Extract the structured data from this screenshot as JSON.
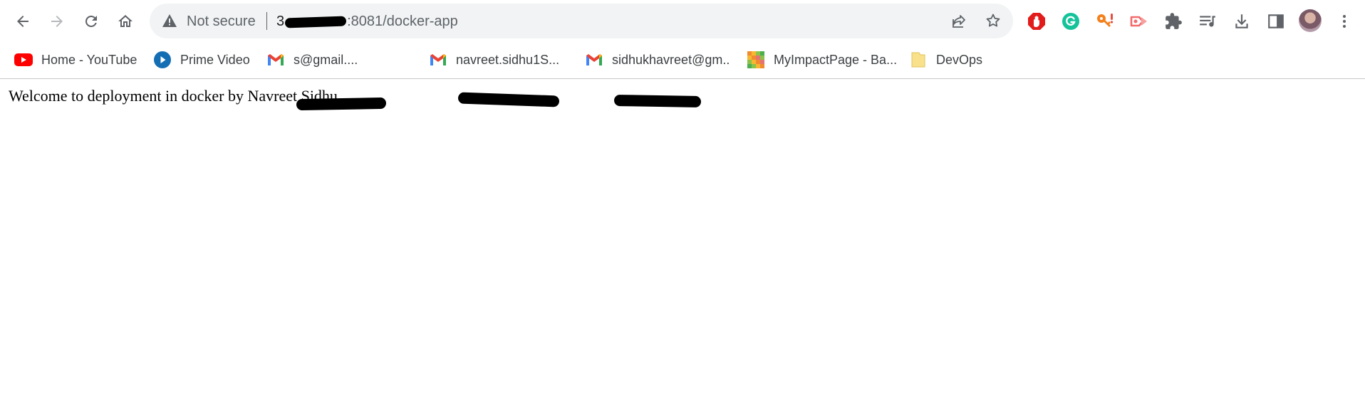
{
  "browser": {
    "nav": {
      "back_label": "Back",
      "forward_label": "Forward",
      "reload_label": "Reload",
      "home_label": "Home"
    },
    "omnibox": {
      "security_text": "Not secure",
      "url_visible_prefix": "3",
      "url_visible_suffix": ":8081/docker-app",
      "redacted": true
    },
    "extensions": [
      {
        "name": "adblock-extension-icon",
        "color": "#e21b1b"
      },
      {
        "name": "grammarly-extension-icon",
        "color": "#15c39a"
      },
      {
        "name": "key-extension-icon",
        "color": "#f4801a"
      },
      {
        "name": "screen-recorder-extension-icon",
        "color": "#f26b6b"
      },
      {
        "name": "extensions-puzzle-icon",
        "color": "#5f6368"
      },
      {
        "name": "reading-list-icon",
        "color": "#5f6368"
      },
      {
        "name": "download-icon",
        "color": "#5f6368"
      },
      {
        "name": "side-panel-icon",
        "color": "#5f6368"
      }
    ]
  },
  "bookmarks": [
    {
      "label": "Home - YouTube",
      "icon": "youtube-icon"
    },
    {
      "label": "Prime Video",
      "icon": "prime-video-icon"
    },
    {
      "label": "s@gmail....",
      "icon": "gmail-icon",
      "redacted": true
    },
    {
      "label": "navreet.sidhu1S...",
      "icon": "gmail-icon",
      "redacted": true
    },
    {
      "label": "sidhukhavreet@gm...",
      "icon": "gmail-icon",
      "redacted": true
    },
    {
      "label": "MyImpactPage - Ba...",
      "icon": "myimpactpage-icon"
    },
    {
      "label": "DevOps",
      "icon": "folder-icon"
    }
  ],
  "page": {
    "content_text": "Welcome to deployment in docker by Navreet Sidhu"
  },
  "colors": {
    "toolbar_bg": "#ffffff",
    "omnibox_bg": "#f1f3f4",
    "icon_gray": "#5f6368",
    "text_dark": "#202124"
  }
}
